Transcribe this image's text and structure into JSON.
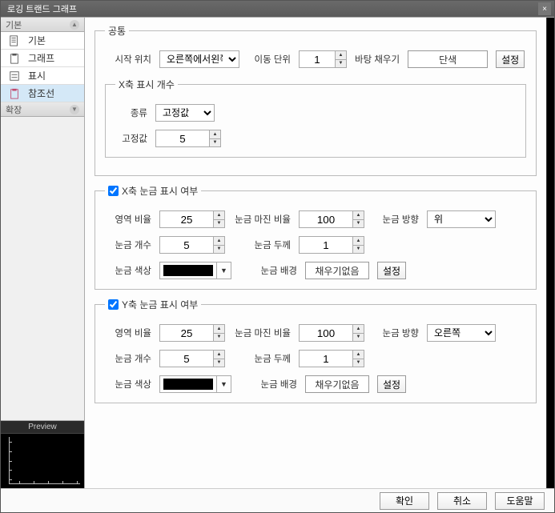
{
  "title": "로깅 트랜드 그래프",
  "sidebar": {
    "catBasic": "기본",
    "catExpand": "확장",
    "items": [
      "기본",
      "그래프",
      "표시",
      "참조선"
    ]
  },
  "preview": {
    "label": "Preview"
  },
  "common": {
    "legend": "공통",
    "startPosLabel": "시작 위치",
    "startPosValue": "오른쪽에서왼쪽",
    "moveUnitLabel": "이동 단위",
    "moveUnitValue": "1",
    "bgFillLabel": "바탕 채우기",
    "bgFillValue": "단색",
    "bgFillBtn": "설정"
  },
  "xcount": {
    "legend": "X축 표시 개수",
    "typeLabel": "종류",
    "typeValue": "고정값",
    "fixedLabel": "고정값",
    "fixedValue": "5"
  },
  "xgrad": {
    "legend": "X축 눈금 표시 여부",
    "checked": true,
    "areaRatioLabel": "영역 비율",
    "areaRatioValue": "25",
    "marginRatioLabel": "눈금 마진 비율",
    "marginRatioValue": "100",
    "directionLabel": "눈금 방향",
    "directionValue": "위",
    "countLabel": "눈금 개수",
    "countValue": "5",
    "thicknessLabel": "눈금 두께",
    "thicknessValue": "1",
    "colorLabel": "눈금 색상",
    "bgLabel": "눈금 배경",
    "bgValue": "채우기없음",
    "bgBtn": "설정"
  },
  "ygrad": {
    "legend": "Y축 눈금 표시 여부",
    "checked": true,
    "areaRatioLabel": "영역 비율",
    "areaRatioValue": "25",
    "marginRatioLabel": "눈금 마진 비율",
    "marginRatioValue": "100",
    "directionLabel": "눈금 방향",
    "directionValue": "오른쪽",
    "countLabel": "눈금 개수",
    "countValue": "5",
    "thicknessLabel": "눈금 두께",
    "thicknessValue": "1",
    "colorLabel": "눈금 색상",
    "bgLabel": "눈금 배경",
    "bgValue": "채우기없음",
    "bgBtn": "설정"
  },
  "footer": {
    "ok": "확인",
    "cancel": "취소",
    "help": "도움말"
  }
}
